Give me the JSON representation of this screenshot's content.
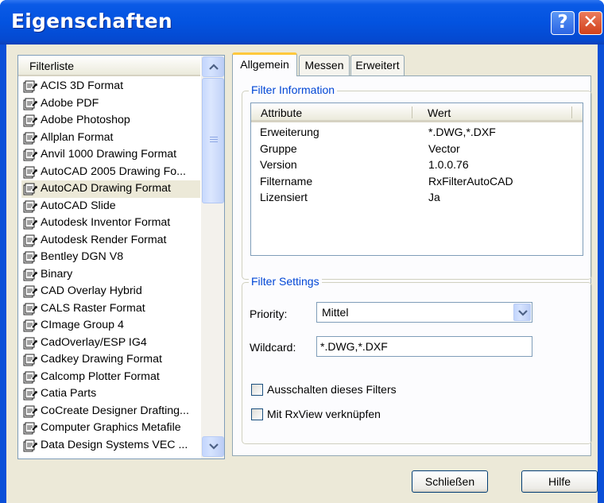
{
  "window": {
    "title": "Eigenschaften",
    "help_glyph": "?",
    "close_glyph": "✕"
  },
  "filter_list": {
    "header": "Filterliste",
    "selected_index": 6,
    "items": [
      "ACIS 3D Format",
      "Adobe PDF",
      "Adobe Photoshop",
      "Allplan Format",
      "Anvil 1000 Drawing Format",
      "AutoCAD 2005 Drawing Fo...",
      "AutoCAD Drawing Format",
      "AutoCAD Slide",
      "Autodesk Inventor Format",
      "Autodesk Render Format",
      "Bentley DGN V8",
      "Binary",
      "CAD Overlay Hybrid",
      "CALS Raster Format",
      "CImage Group 4",
      "CadOverlay/ESP IG4",
      "Cadkey Drawing Format",
      "Calcomp Plotter Format",
      "Catia Parts",
      "CoCreate Designer Drafting...",
      "Computer Graphics Metafile",
      "Data Design Systems VEC ..."
    ]
  },
  "tabs": [
    {
      "label": "Allgemein",
      "active": true
    },
    {
      "label": "Messen",
      "active": false
    },
    {
      "label": "Erweitert",
      "active": false
    }
  ],
  "filter_info": {
    "group_title": "Filter Information",
    "col_attribute": "Attribute",
    "col_value": "Wert",
    "rows": [
      {
        "attr": "Erweiterung",
        "value": "*.DWG,*.DXF"
      },
      {
        "attr": "Gruppe",
        "value": "Vector"
      },
      {
        "attr": "Version",
        "value": "1.0.0.76"
      },
      {
        "attr": "Filtername",
        "value": "RxFilterAutoCAD"
      },
      {
        "attr": "Lizensiert",
        "value": "Ja"
      }
    ]
  },
  "filter_settings": {
    "group_title": "Filter Settings",
    "priority_label": "Priority:",
    "priority_value": "Mittel",
    "wildcard_label": "Wildcard:",
    "wildcard_value": "*.DWG,*.DXF",
    "checkbox_disable_label": "Ausschalten dieses Filters",
    "checkbox_disable_checked": false,
    "checkbox_rxview_label": "Mit RxView verknüpfen",
    "checkbox_rxview_checked": false
  },
  "buttons": {
    "close_label": "Schließen",
    "help_label": "Hilfe"
  },
  "colors": {
    "titlebar": "#0353e0",
    "dialog_bg": "#ece9d8",
    "group_title": "#0046d5",
    "active_tab_highlight": "#ffc83c"
  }
}
